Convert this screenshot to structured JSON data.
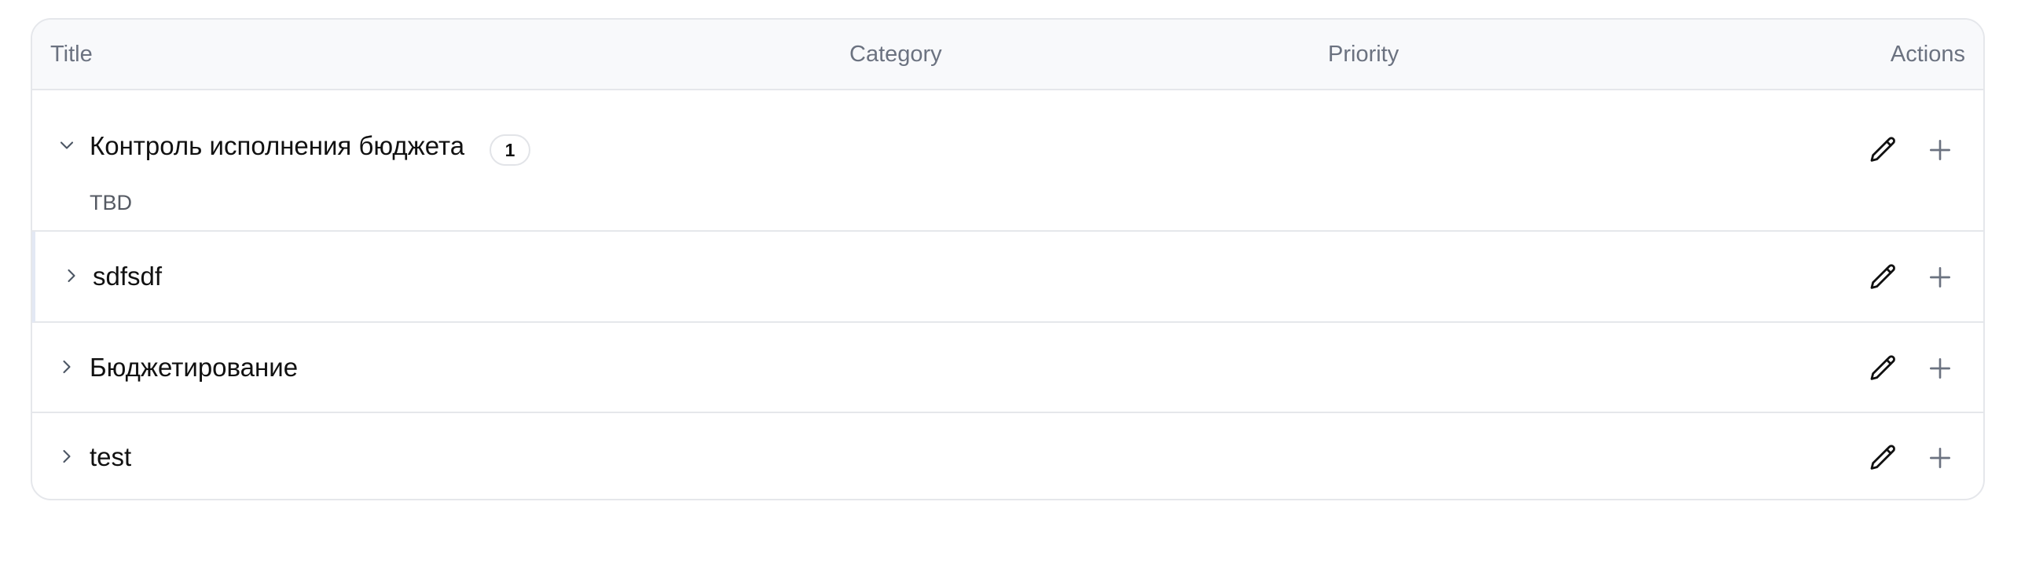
{
  "table": {
    "columns": {
      "title": "Title",
      "category": "Category",
      "priority": "Priority",
      "actions": "Actions"
    },
    "rows": [
      {
        "title": "Контроль исполнения бюджета",
        "expanded": true,
        "count_badge": "1",
        "description": "TBD",
        "category": "",
        "priority": ""
      },
      {
        "title": "sdfsdf",
        "expanded": false,
        "selected": true,
        "category": "",
        "priority": ""
      },
      {
        "title": "Бюджетирование",
        "expanded": false,
        "category": "",
        "priority": ""
      },
      {
        "title": "test",
        "expanded": false,
        "category": "",
        "priority": ""
      }
    ]
  },
  "icons": {
    "expanded": "chevron-down-icon",
    "collapsed": "chevron-right-icon",
    "edit": "pencil-icon",
    "add": "plus-icon"
  }
}
